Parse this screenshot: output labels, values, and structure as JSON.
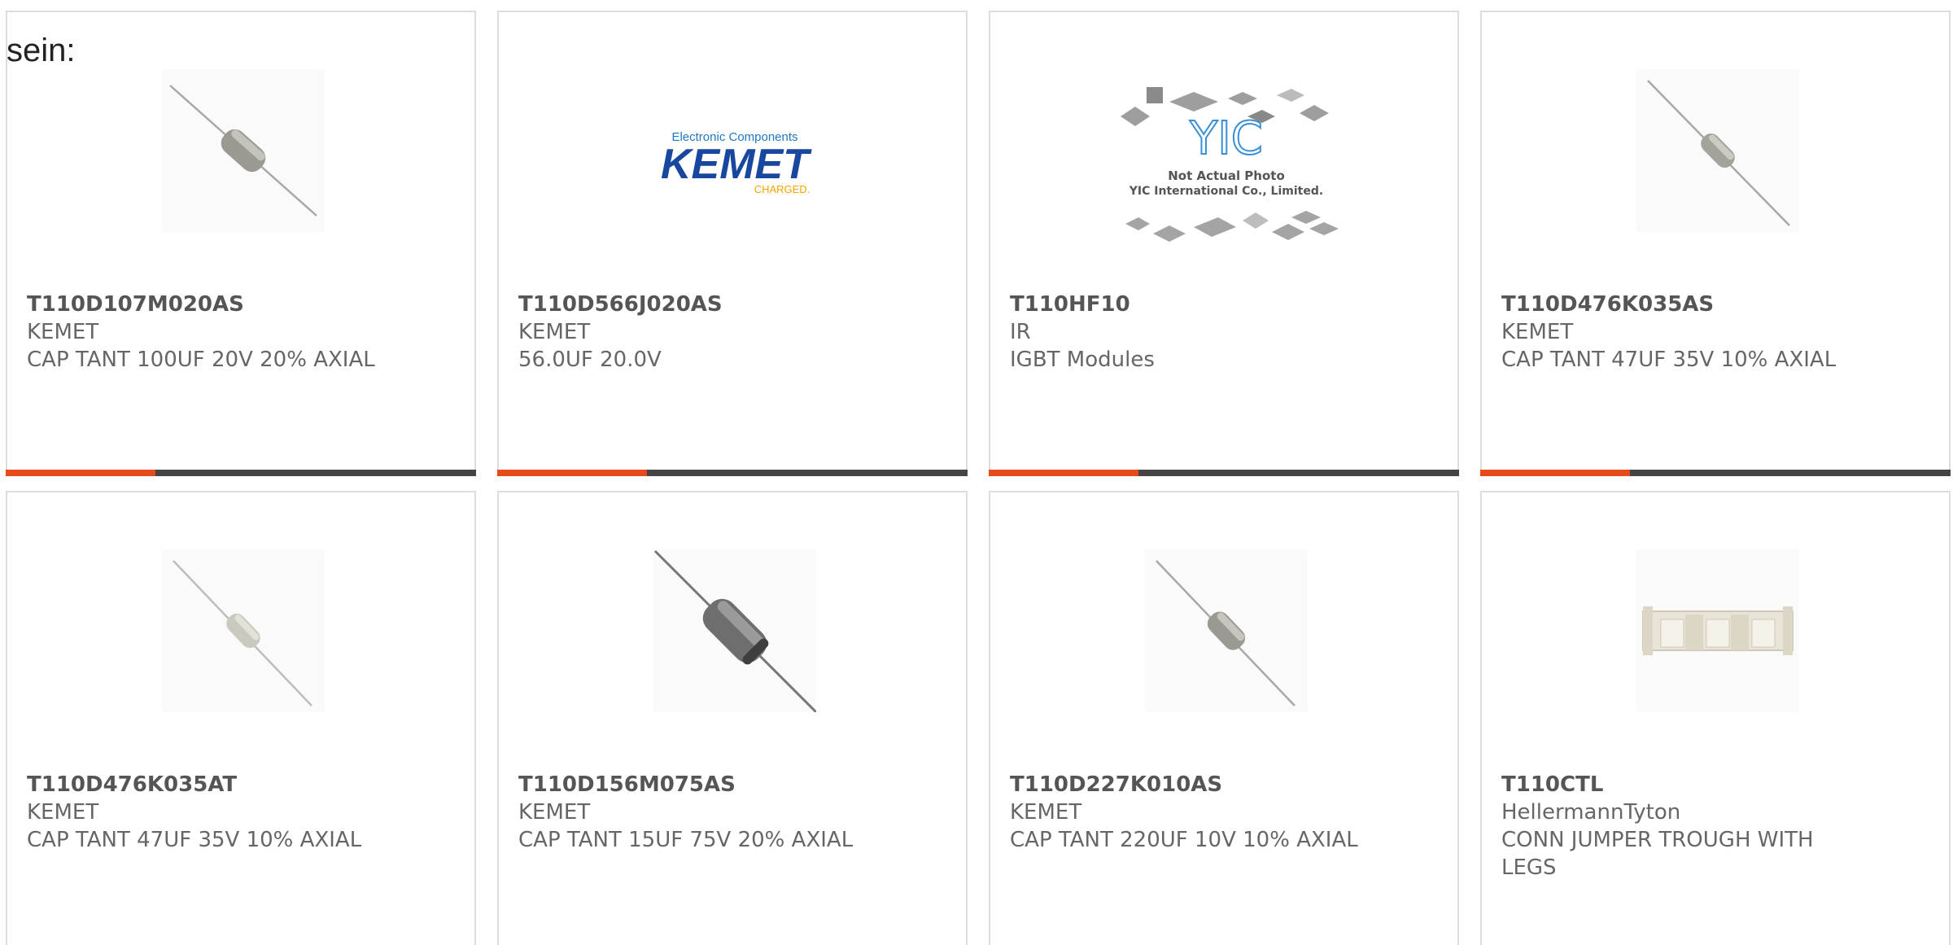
{
  "intro_text": "sein:",
  "colors": {
    "card_border": "#dddddd",
    "bar_dark": "#444444",
    "bar_accent": "#e84a1c",
    "part_number": "#555555",
    "secondary_text": "#666666"
  },
  "products": [
    {
      "part_number": "T110D107M020AS",
      "manufacturer": "KEMET",
      "description": "CAP TANT 100UF 20V 20% AXIAL",
      "image": "axial-capacitor-image"
    },
    {
      "part_number": "T110D566J020AS",
      "manufacturer": "KEMET",
      "description": "56.0UF 20.0V",
      "image": "kemet-logo-image",
      "logo": {
        "tagline": "Electronic Components",
        "name": "KEMET",
        "sub": "CHARGED."
      }
    },
    {
      "part_number": "T110HF10",
      "manufacturer": "IR",
      "description": "IGBT Modules",
      "image": "yic-placeholder-image",
      "placeholder": {
        "logo": "YIC",
        "line1": "Not Actual Photo",
        "line2": "YIC International Co., Limited."
      }
    },
    {
      "part_number": "T110D476K035AS",
      "manufacturer": "KEMET",
      "description": "CAP TANT 47UF 35V 10% AXIAL",
      "image": "axial-capacitor-image"
    },
    {
      "part_number": "T110D476K035AT",
      "manufacturer": "KEMET",
      "description": "CAP TANT 47UF 35V 10% AXIAL",
      "image": "axial-capacitor-image"
    },
    {
      "part_number": "T110D156M075AS",
      "manufacturer": "KEMET",
      "description": "CAP TANT 15UF 75V 20% AXIAL",
      "image": "axial-capacitor-large-image"
    },
    {
      "part_number": "T110D227K010AS",
      "manufacturer": "KEMET",
      "description": "CAP TANT 220UF 10V 10% AXIAL",
      "image": "axial-capacitor-image"
    },
    {
      "part_number": "T110CTL",
      "manufacturer": "HellermannTyton",
      "description": "CONN JUMPER TROUGH WITH LEGS",
      "image": "jumper-trough-image"
    }
  ]
}
